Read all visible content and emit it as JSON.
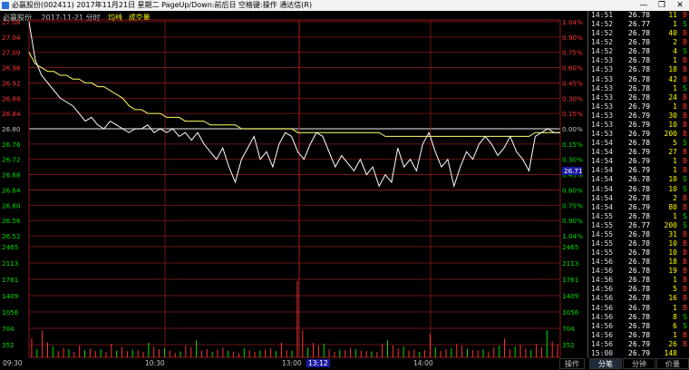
{
  "window": {
    "title": "必赢股份(002411) 2017年11月21日 星期二 PageUp/Down:前后日 空格键:操作 通达信(R)",
    "minimize_glyph": "—",
    "restore_glyph": "❐",
    "close_glyph": "✕"
  },
  "header": {
    "stock": "必赢股份",
    "date": "2017-11-21 分时",
    "avg_label": "均线",
    "vol_label": "成交量"
  },
  "colors": {
    "up": "#ff3333",
    "down": "#00dd00",
    "price_line": "#ffffff",
    "avg_line": "#ffff66",
    "grid": "#8b1a1a",
    "axis_time": "#c0c0c0",
    "highlight_time_bg": "#1a1aa0"
  },
  "current_price_tag": "26.71",
  "current_time_tag": "13:12",
  "chart_data": [
    {
      "type": "line",
      "title": "",
      "x_ticks": [
        "09:30",
        "10:30",
        "13:00",
        "14:00"
      ],
      "y_left_ticks": [
        "27.08",
        "27.04",
        "27.00",
        "26.96",
        "26.92",
        "26.88",
        "26.84",
        "26.80",
        "26.76",
        "26.72",
        "26.68",
        "26.64",
        "26.60",
        "26.56",
        "26.52"
      ],
      "y_right_ticks": [
        "1.04%",
        "0.90%",
        "0.75%",
        "0.60%",
        "0.45%",
        "0.30%",
        "0.15%",
        "0.00%",
        "0.15%",
        "0.30%",
        "0.45%",
        "0.60%",
        "0.75%",
        "0.90%",
        "1.04%"
      ],
      "ylim": [
        26.52,
        27.08
      ],
      "prev_close": 26.8,
      "series": [
        {
          "values": [
            27.08,
            26.98,
            26.94,
            26.92,
            26.9,
            26.88,
            26.87,
            26.86,
            26.84,
            26.82,
            26.83,
            26.81,
            26.8,
            26.82,
            26.81,
            26.8,
            26.79,
            26.8,
            26.8,
            26.81,
            26.79,
            26.8,
            26.79,
            26.8,
            26.78,
            26.79,
            26.77,
            26.79,
            26.76,
            26.74,
            26.72,
            26.75,
            26.7,
            26.66,
            26.72,
            26.75,
            26.78,
            26.72,
            26.74,
            26.7,
            26.76,
            26.79,
            26.78,
            26.74,
            26.72,
            26.76,
            26.79,
            26.78,
            26.74,
            26.7,
            26.73,
            26.71,
            26.69,
            26.72,
            26.68,
            26.7,
            26.65,
            26.68,
            26.66,
            26.75,
            26.7,
            26.72,
            26.69,
            26.76,
            26.79,
            26.74,
            26.7,
            26.72,
            26.65,
            26.7,
            26.74,
            26.72,
            26.76,
            26.78,
            26.76,
            26.73,
            26.75,
            26.78,
            26.74,
            26.72,
            26.69,
            26.78,
            26.79,
            26.8,
            26.79,
            26.79
          ]
        },
        {
          "values": [
            27.0,
            26.97,
            26.96,
            26.95,
            26.95,
            26.94,
            26.94,
            26.93,
            26.93,
            26.92,
            26.92,
            26.91,
            26.91,
            26.9,
            26.89,
            26.88,
            26.86,
            26.85,
            26.85,
            26.84,
            26.84,
            26.84,
            26.83,
            26.83,
            26.83,
            26.82,
            26.82,
            26.82,
            26.82,
            26.81,
            26.81,
            26.81,
            26.81,
            26.81,
            26.8,
            26.8,
            26.8,
            26.8,
            26.8,
            26.8,
            26.8,
            26.8,
            26.8,
            26.79,
            26.79,
            26.79,
            26.79,
            26.79,
            26.79,
            26.79,
            26.79,
            26.79,
            26.79,
            26.79,
            26.79,
            26.79,
            26.79,
            26.78,
            26.78,
            26.78,
            26.78,
            26.78,
            26.78,
            26.78,
            26.78,
            26.78,
            26.78,
            26.78,
            26.78,
            26.78,
            26.78,
            26.78,
            26.78,
            26.78,
            26.78,
            26.78,
            26.78,
            26.78,
            26.78,
            26.78,
            26.78,
            26.79,
            26.79,
            26.79,
            26.79,
            26.79
          ]
        }
      ]
    },
    {
      "type": "bar",
      "title": "",
      "y_ticks": [
        "2465",
        "2113",
        "1761",
        "1409",
        "1056",
        "704",
        "352"
      ],
      "ylim": [
        0,
        2465
      ],
      "values": [
        420,
        180,
        600,
        330,
        250,
        140,
        210,
        180,
        120,
        260,
        160,
        200,
        140,
        180,
        110,
        300,
        150,
        220,
        140,
        170,
        160,
        120,
        330,
        240,
        180,
        200,
        150,
        100,
        130,
        260,
        220,
        380,
        150,
        180,
        120,
        170,
        210,
        150,
        130,
        90,
        200,
        160,
        120,
        150,
        170,
        200,
        140,
        330,
        160,
        150,
        1700,
        600,
        220,
        320,
        260,
        300,
        180,
        120,
        170,
        160,
        210,
        180,
        150,
        140,
        130,
        120,
        300,
        380,
        260,
        200,
        240,
        150,
        170,
        120,
        160,
        520,
        220,
        140,
        180,
        200,
        300,
        260,
        190,
        160,
        150,
        180,
        120,
        220,
        260,
        420,
        180,
        240,
        280,
        200,
        160,
        300,
        220,
        600,
        350,
        280
      ],
      "colors": [
        "up",
        "down"
      ]
    }
  ],
  "trades": [
    {
      "time": "14:51",
      "price": "26.78",
      "vol": "11",
      "side": "B"
    },
    {
      "time": "14:52",
      "price": "26.77",
      "vol": "1",
      "side": "S"
    },
    {
      "time": "14:52",
      "price": "26.78",
      "vol": "40",
      "side": "B"
    },
    {
      "time": "14:52",
      "price": "26.78",
      "vol": "2",
      "side": "B"
    },
    {
      "time": "14:52",
      "price": "26.78",
      "vol": "4",
      "side": "S"
    },
    {
      "time": "14:53",
      "price": "26.78",
      "vol": "1",
      "side": "B"
    },
    {
      "time": "14:53",
      "price": "26.78",
      "vol": "18",
      "side": "B"
    },
    {
      "time": "14:53",
      "price": "26.78",
      "vol": "42",
      "side": "B"
    },
    {
      "time": "14:53",
      "price": "26.78",
      "vol": "1",
      "side": "S"
    },
    {
      "time": "14:53",
      "price": "26.78",
      "vol": "24",
      "side": "B"
    },
    {
      "time": "14:53",
      "price": "26.79",
      "vol": "1",
      "side": "B"
    },
    {
      "time": "14:53",
      "price": "26.79",
      "vol": "30",
      "side": "B"
    },
    {
      "time": "14:53",
      "price": "26.79",
      "vol": "10",
      "side": "B"
    },
    {
      "time": "14:53",
      "price": "26.79",
      "vol": "200",
      "side": "B"
    },
    {
      "time": "14:54",
      "price": "26.78",
      "vol": "5",
      "side": "S"
    },
    {
      "time": "14:54",
      "price": "26.79",
      "vol": "27",
      "side": "B"
    },
    {
      "time": "14:54",
      "price": "26.79",
      "vol": "1",
      "side": "B"
    },
    {
      "time": "14:54",
      "price": "26.79",
      "vol": "1",
      "side": "B"
    },
    {
      "time": "14:54",
      "price": "26.78",
      "vol": "10",
      "side": "S"
    },
    {
      "time": "14:54",
      "price": "26.78",
      "vol": "10",
      "side": "S"
    },
    {
      "time": "14:54",
      "price": "26.78",
      "vol": "2",
      "side": "B"
    },
    {
      "time": "14:54",
      "price": "26.79",
      "vol": "80",
      "side": "B"
    },
    {
      "time": "14:55",
      "price": "26.78",
      "vol": "1",
      "side": "S"
    },
    {
      "time": "14:55",
      "price": "26.77",
      "vol": "200",
      "side": "S"
    },
    {
      "time": "14:55",
      "price": "26.78",
      "vol": "31",
      "side": "B"
    },
    {
      "time": "14:55",
      "price": "26.78",
      "vol": "10",
      "side": "B"
    },
    {
      "time": "14:55",
      "price": "26.78",
      "vol": "10",
      "side": "B"
    },
    {
      "time": "14:56",
      "price": "26.78",
      "vol": "18",
      "side": "B"
    },
    {
      "time": "14:56",
      "price": "26.78",
      "vol": "19",
      "side": "B"
    },
    {
      "time": "14:56",
      "price": "26.78",
      "vol": "1",
      "side": "B"
    },
    {
      "time": "14:56",
      "price": "26.78",
      "vol": "5",
      "side": "B"
    },
    {
      "time": "14:56",
      "price": "26.78",
      "vol": "16",
      "side": "B"
    },
    {
      "time": "14:56",
      "price": "26.78",
      "vol": "1",
      "side": "B"
    },
    {
      "time": "14:56",
      "price": "26.78",
      "vol": "8",
      "side": "S"
    },
    {
      "time": "14:56",
      "price": "26.78",
      "vol": "6",
      "side": "S"
    },
    {
      "time": "14:56",
      "price": "26.78",
      "vol": "1",
      "side": "B"
    },
    {
      "time": "14:56",
      "price": "26.79",
      "vol": "26",
      "side": "B"
    },
    {
      "time": "15:00",
      "price": "26.79",
      "vol": "148",
      "side": ""
    }
  ],
  "bottom_tabs": {
    "ops": "操作",
    "fenbi": "分笔",
    "fenzhong": "分钟",
    "jiage": "价量"
  }
}
